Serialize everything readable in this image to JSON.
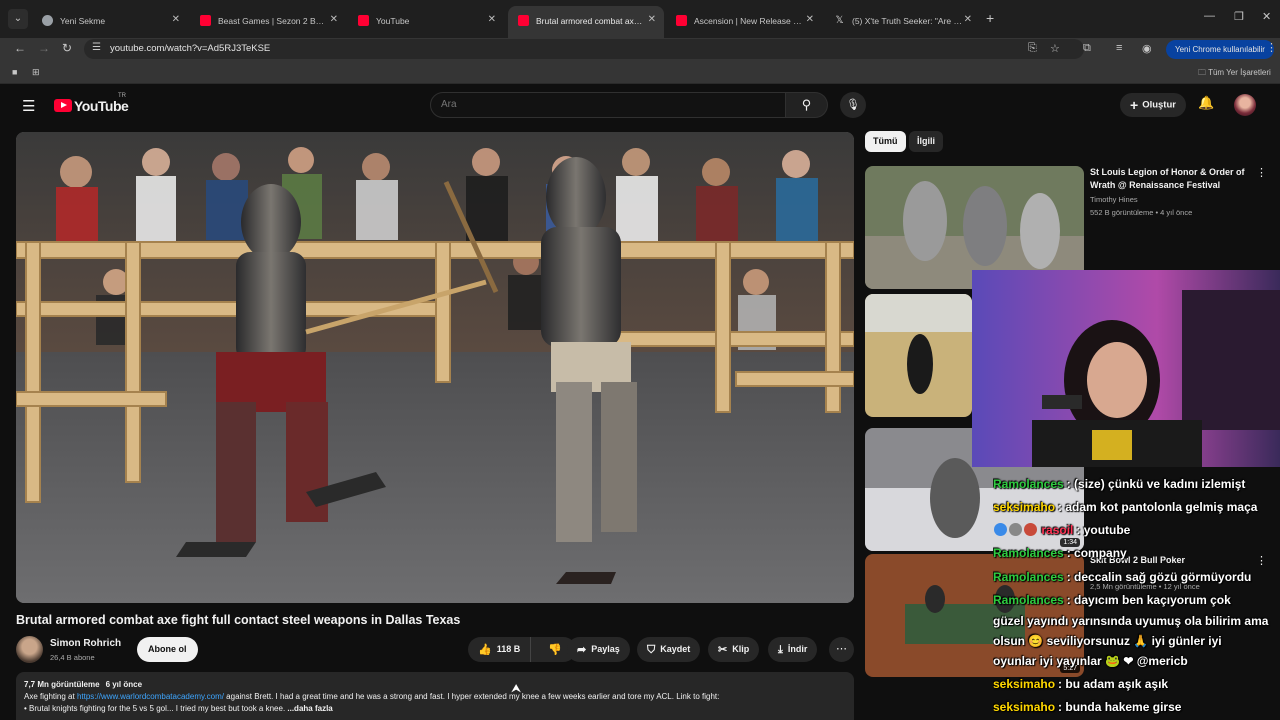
{
  "browser": {
    "tabs": [
      {
        "label": "Yeni Sekme",
        "favicon": "chrome-icon",
        "active": false
      },
      {
        "label": "Beast Games | Sezon 2 Bölüm 2",
        "favicon": "youtube-icon",
        "active": false
      },
      {
        "label": "YouTube",
        "favicon": "youtube-icon",
        "active": false
      },
      {
        "label": "Brutal armored combat axe fight",
        "favicon": "youtube-icon",
        "active": true
      },
      {
        "label": "Ascension | New Release Date T",
        "favicon": "youtube-icon",
        "active": false
      },
      {
        "label": "(5) X'te Truth Seeker: \"Are you a",
        "favicon": "x-icon",
        "active": false
      }
    ],
    "url": "youtube.com/watch?v=Ad5RJ3TeKSE",
    "chrome_update_label": "Yeni Chrome kullanılabilir",
    "bookmarks_all_label": "Tüm Yer İşaretleri"
  },
  "youtube": {
    "logo_text": "YouTube",
    "logo_country": "TR",
    "search_placeholder": "Ara",
    "create_label": "Oluştur"
  },
  "video": {
    "title": "Brutal armored combat axe fight full contact steel weapons in Dallas Texas",
    "channel_name": "Simon Rohrich",
    "subscribers": "26,4 B abone",
    "subscribe_label": "Abone ol",
    "likes": "118 B",
    "share_label": "Paylaş",
    "save_label": "Kaydet",
    "clip_label": "Klip",
    "download_label": "İndir",
    "views": "7,7 Mn görüntüleme",
    "age": "6 yıl önce",
    "desc_prefix": "Axe fighting at",
    "desc_link": "https://www.warlordcombatacademy.com/",
    "desc_rest": " against Brett. I had a great time and he was a strong and fast. I hyper extended my knee a few weeks earlier and tore my ACL. Link to fight:",
    "desc_line2": "• Brutal knights fighting for the 5 vs 5 gol...    I tried my best but took a knee. ",
    "desc_more": "...daha fazla"
  },
  "sidebar": {
    "chips": [
      "Tümü",
      "İlgili"
    ],
    "recs": [
      {
        "title": "St Louis Legion of Honor & Order of Wrath @ Renaissance Festival",
        "channel": "Timothy Hines",
        "meta": "552 B görüntüleme • 4 yıl önce",
        "duration": ""
      },
      {
        "title": "",
        "channel": "",
        "meta": "",
        "duration": ""
      },
      {
        "title": "",
        "channel": "",
        "meta": "",
        "duration": "1:34"
      },
      {
        "title": "Skit Bowl 2 Bull Poker",
        "channel": "",
        "meta": "2,5 Mn görüntüleme • 12 yıl önce",
        "duration": "5:27"
      }
    ]
  },
  "chat": [
    {
      "user": "Ramolances",
      "user_color": "#2ecc40",
      "text": ": (size) çünkü ve kadını izlemişt"
    },
    {
      "user": "seksimaho",
      "user_color": "#ffd700",
      "text": ": adam kot pantolonla gelmiş maça"
    },
    {
      "user": "rasoil",
      "user_color": "#ff3355",
      "text": ": youtube",
      "emotes": true
    },
    {
      "user": "Ramolances",
      "user_color": "#2ecc40",
      "text": ": company"
    },
    {
      "user": "Ramolances",
      "user_color": "#2ecc40",
      "text": ": deccalin sağ gözü görmüyordu"
    },
    {
      "user": "Ramolances",
      "user_color": "#2ecc40",
      "text": ": dayıcım ben kaçıyorum çok"
    },
    {
      "user": "",
      "user_color": "#ffffff",
      "text": "güzel yayındı yarınsında uyumuş ola bilirim ama"
    },
    {
      "user": "",
      "user_color": "#ffffff",
      "text": "olsun 😊 seviliyorsunuz 🙏 iyi günler iyi"
    },
    {
      "user": "",
      "user_color": "#ffffff",
      "text": "oyunlar iyi yayınlar 🐸 ❤ @mericb"
    },
    {
      "user": "seksimaho",
      "user_color": "#ffd700",
      "text": ": bu adam aşık aşık"
    },
    {
      "user": "seksimaho",
      "user_color": "#ffd700",
      "text": ": bunda hakeme girse"
    }
  ]
}
